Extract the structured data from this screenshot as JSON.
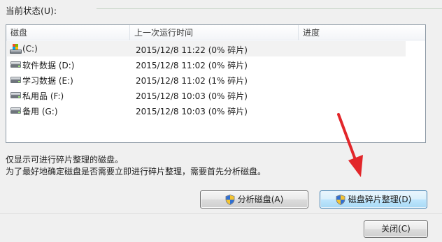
{
  "status": {
    "label": "当前状态(U):"
  },
  "columns": {
    "disk": "磁盘",
    "last_run": "上一次运行时间",
    "progress": "进度"
  },
  "disks": [
    {
      "name": "(C:)",
      "last_run": "2015/12/8 11:22 (0% 碎片)",
      "progress": "",
      "icon": "system-drive-icon"
    },
    {
      "name": "软件数据 (D:)",
      "last_run": "2015/12/8 11:02 (0% 碎片)",
      "progress": "",
      "icon": "drive-icon"
    },
    {
      "name": "学习数据 (E:)",
      "last_run": "2015/12/8 11:02 (1% 碎片)",
      "progress": "",
      "icon": "drive-icon"
    },
    {
      "name": "私用品 (F:)",
      "last_run": "2015/12/8 10:03 (0% 碎片)",
      "progress": "",
      "icon": "drive-icon"
    },
    {
      "name": "备用 (G:)",
      "last_run": "2015/12/8 10:03 (0% 碎片)",
      "progress": "",
      "icon": "drive-icon"
    }
  ],
  "notes": {
    "line1": "仅显示可进行碎片整理的磁盘。",
    "line2": "为了最好地确定磁盘是否需要立即进行碎片整理，需要首先分析磁盘。"
  },
  "buttons": {
    "analyze": "分析磁盘(A)",
    "defrag": "磁盘碎片整理(D)",
    "close": "关闭(C)"
  },
  "colors": {
    "annotation_arrow": "#e2262a",
    "focus_border": "#3c7fb1"
  }
}
